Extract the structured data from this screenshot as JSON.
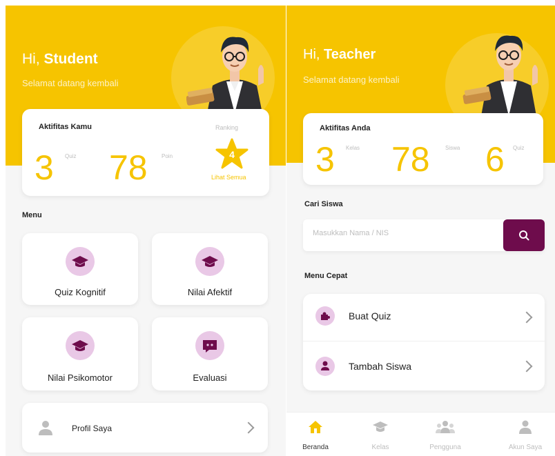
{
  "colors": {
    "accent": "#f6c400",
    "brand_purple": "#6e0c4c",
    "icon_bg": "#e9c8e6",
    "bg": "#f6f6f6"
  },
  "student": {
    "greeting_prefix": "Hi, ",
    "greeting_name": "Student",
    "subtitle": "Selamat datang kembali",
    "activity": {
      "title": "Aktifitas Kamu",
      "quiz_value": "3",
      "quiz_unit": "Quiz",
      "points_value": "78",
      "points_unit": "Poin",
      "ranking_label": "Ranking",
      "ranking_value": "4",
      "see_all": "Lihat Semua"
    },
    "menu_title": "Menu",
    "menu_items": [
      {
        "label": "Quiz Kognitif",
        "icon": "graduation-cap-icon"
      },
      {
        "label": "Nilai Afektif",
        "icon": "graduation-cap-icon"
      },
      {
        "label": "Nilai Psikomotor",
        "icon": "graduation-cap-icon"
      },
      {
        "label": "Evaluasi",
        "icon": "chat-icon"
      }
    ],
    "profile_label": "Profil Saya"
  },
  "teacher": {
    "greeting_prefix": "Hi, ",
    "greeting_name": "Teacher",
    "subtitle": "Selamat datang kembali",
    "activity": {
      "title": "Aktifitas Anda",
      "class_value": "3",
      "class_unit": "Kelas",
      "student_value": "78",
      "student_unit": "Siswa",
      "quiz_value": "6",
      "quiz_unit": "Quiz"
    },
    "search_title": "Cari Siswa",
    "search_placeholder": "Masukkan Nama / NIS",
    "quick_title": "Menu Cepat",
    "quick_items": [
      {
        "label": "Buat Quiz",
        "icon": "puzzle-icon"
      },
      {
        "label": "Tambah Siswa",
        "icon": "user-icon"
      }
    ],
    "nav": [
      {
        "label": "Beranda",
        "icon": "home-icon",
        "active": true
      },
      {
        "label": "Kelas",
        "icon": "graduation-cap-icon",
        "active": false
      },
      {
        "label": "Pengguna",
        "icon": "users-icon",
        "active": false
      },
      {
        "label": "Akun Saya",
        "icon": "account-icon",
        "active": false
      }
    ]
  }
}
